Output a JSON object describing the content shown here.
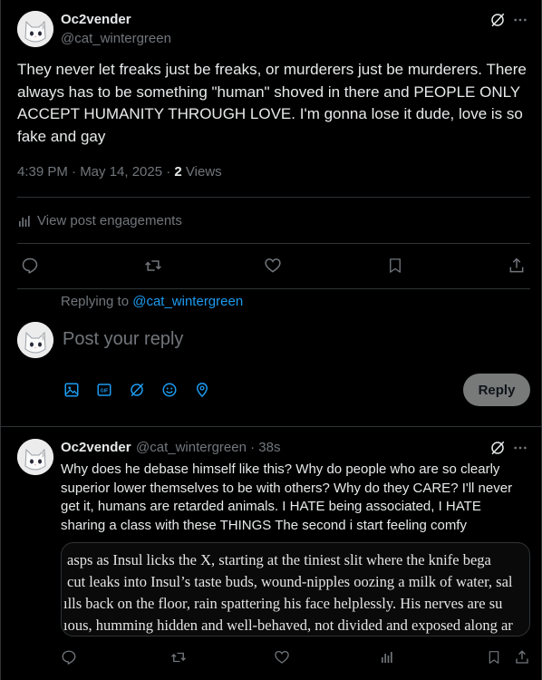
{
  "main_tweet": {
    "display_name": "Oc2vender",
    "handle": "@cat_wintergreen",
    "text": "They never let freaks just be freaks, or murderers just be murderers. There always has to be something \"human\" shoved in there and PEOPLE ONLY ACCEPT HUMANITY THROUGH LOVE. I'm gonna lose it dude, love is so fake and gay",
    "time": "4:39 PM · May 14, 2025 · ",
    "views_count": "2",
    "views_label": " Views",
    "engagements_label": "View post engagements"
  },
  "reply_composer": {
    "replying_to_label": "Replying to ",
    "replying_to_handle": "@cat_wintergreen",
    "placeholder": "Post your reply",
    "reply_button": "Reply"
  },
  "reply_tweet": {
    "display_name": "Oc2vender",
    "handle_time": "@cat_wintergreen · 38s",
    "text": "Why does he debase himself like this? Why do people who are so clearly superior lower themselves to be with others? Why do they CARE? I'll never get it, humans are retarded animals. I HATE being associated, I HATE sharing a class with these THINGS The second i start feeling comfy",
    "media_lines": [
      "asps as Insul licks the X, starting at the tiniest slit where the knife bega",
      "cut leaks into Insul’s taste buds, wound-nipples oozing a milk of water, sal",
      "ılls back on the floor, rain spattering his face helplessly. His nerves are su",
      "ıous, humming hidden and well-behaved, not divided and exposed along ar"
    ]
  },
  "colors": {
    "background": "#000000",
    "text": "#e7e9ea",
    "muted": "#71767b",
    "accent": "#1d9bf0",
    "divider": "#2f3336"
  }
}
